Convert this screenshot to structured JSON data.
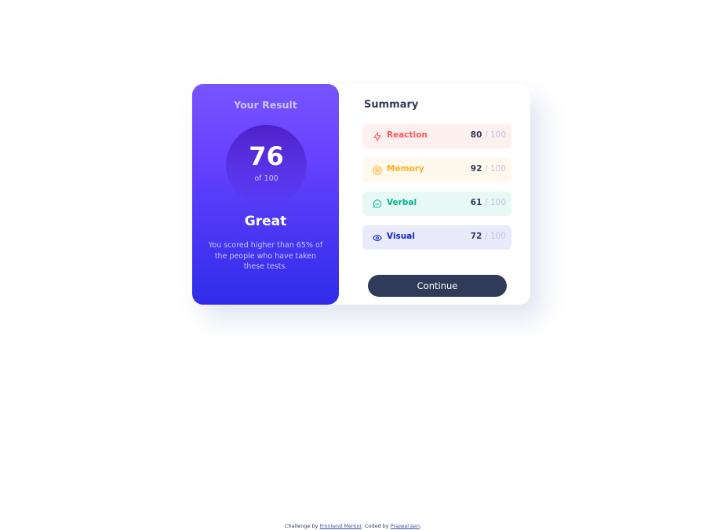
{
  "result": {
    "title": "Your Result",
    "score": "76",
    "out_of": "of 100",
    "grade": "Great",
    "description": "You scored higher than 65% of the people who have taken these tests."
  },
  "summary": {
    "title": "Summary",
    "items": [
      {
        "label": "Reaction",
        "score": "80",
        "max": "/ 100",
        "icon": "lightning-icon",
        "color": "#f55a5a",
        "bg": "#fff0f0"
      },
      {
        "label": "Memory",
        "score": "92",
        "max": "/ 100",
        "icon": "brain-icon",
        "color": "#ffb01f",
        "bg": "#fff8ed"
      },
      {
        "label": "Verbal",
        "score": "61",
        "max": "/ 100",
        "icon": "chat-bubble-icon",
        "color": "#00bb8f",
        "bg": "#e8f8f4"
      },
      {
        "label": "Visual",
        "score": "72",
        "max": "/ 100",
        "icon": "eye-icon",
        "color": "#1125d6",
        "bg": "#e9ebfb"
      }
    ],
    "continue_label": "Continue"
  },
  "footer": {
    "prefix": "Challenge by",
    "challenge_link": "Frontend Mentor",
    "middle": ". Coded by",
    "author_link": "Prajwal Jain",
    "suffix": "."
  },
  "colors": {
    "accent_gradient_top": "#7755ff",
    "accent_gradient_bottom": "#2f2ce9",
    "dark_navy": "#303b59",
    "light_lavender": "#c8c4ff"
  }
}
